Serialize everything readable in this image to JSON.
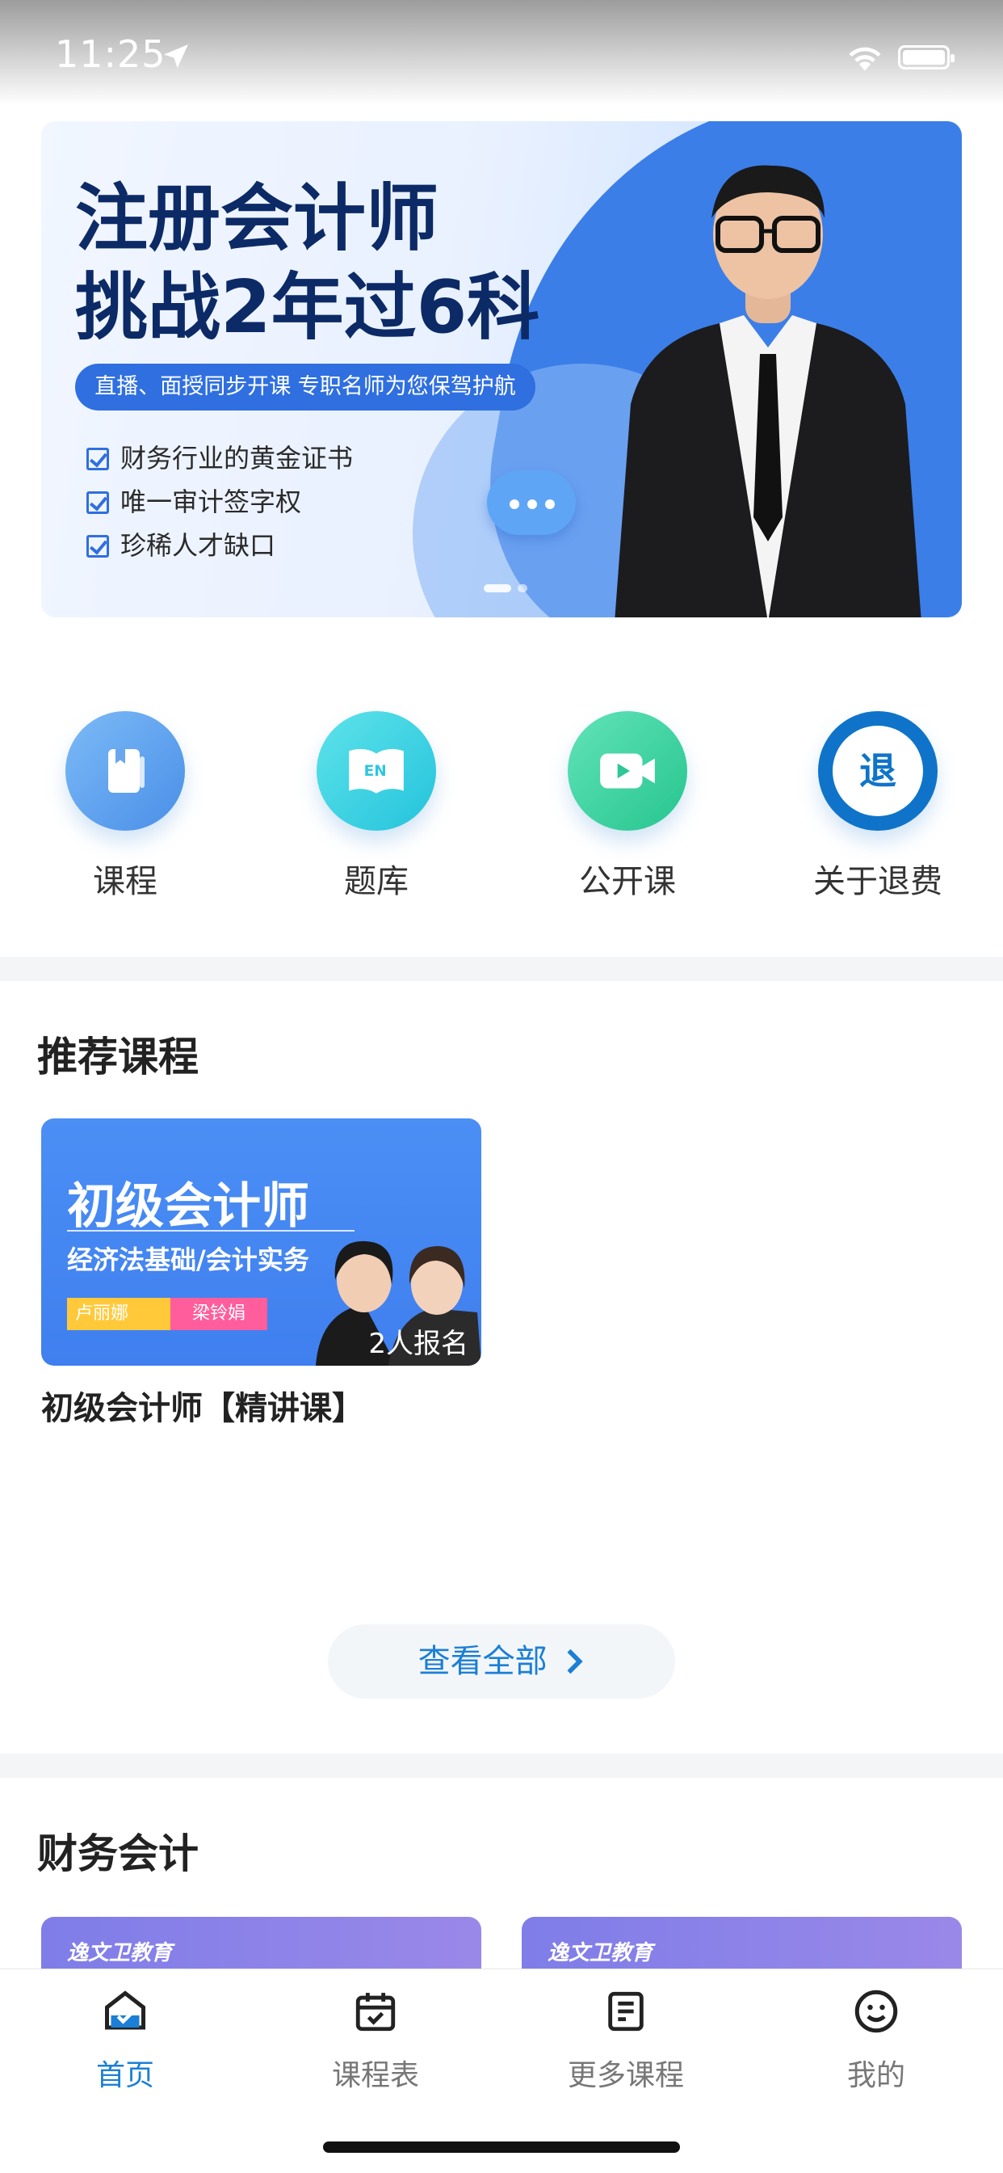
{
  "status_bar": {
    "time": "11:25"
  },
  "banner": {
    "title_line1": "注册会计师",
    "title_line2": "挑战2年过6科",
    "pill": "直播、面授同步开课  专职名师为您保驾护航",
    "checks": [
      "财务行业的黄金证书",
      "唯一审计签字权",
      "珍稀人才缺口"
    ]
  },
  "quick_links": [
    {
      "label": "课程",
      "icon": "book-icon",
      "color": "#5aa3f0"
    },
    {
      "label": "题库",
      "icon": "en-book-icon",
      "color": "#35cde0"
    },
    {
      "label": "公开课",
      "icon": "video-icon",
      "color": "#38d2a4"
    },
    {
      "label": "关于退费",
      "icon": "refund-icon",
      "icon_text": "退",
      "color": "#0f74c9"
    }
  ],
  "recommended": {
    "title": "推荐课程",
    "course": {
      "cover_title": "初级会计师",
      "cover_subtitle": "经济法基础/会计实务",
      "teacher1": "卢丽娜",
      "teacher2": "梁铃娟",
      "enrolled": "2人报名",
      "name": "初级会计师【精讲课】"
    },
    "view_all": "查看全部"
  },
  "finance": {
    "title": "财务会计",
    "card_logo": "逸文卫教育"
  },
  "tabbar": [
    {
      "label": "首页",
      "icon": "home-icon",
      "active": true
    },
    {
      "label": "课程表",
      "icon": "calendar-icon",
      "active": false
    },
    {
      "label": "更多课程",
      "icon": "document-icon",
      "active": false
    },
    {
      "label": "我的",
      "icon": "smiley-icon",
      "active": false
    }
  ],
  "colors": {
    "accent": "#1b7fd6",
    "banner_blue": "#2f6fe0"
  }
}
